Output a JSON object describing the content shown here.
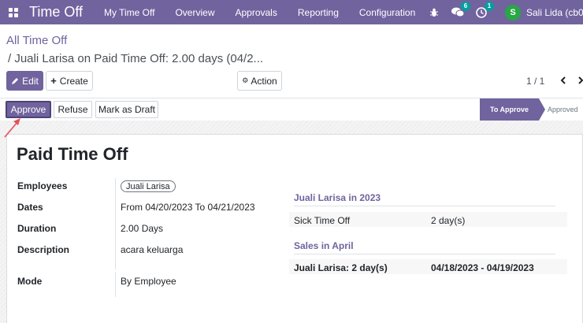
{
  "navbar": {
    "app_name": "Time Off",
    "menu": [
      "My Time Off",
      "Overview",
      "Approvals",
      "Reporting",
      "Configuration"
    ],
    "messages_count": "6",
    "activities_count": "1",
    "avatar_letter": "S",
    "user_name": "Sali Lida (cb0",
    "color": "#71639e"
  },
  "breadcrumb": {
    "parent": "All Time Off",
    "current": "/ Juali Larisa on Paid Time Off: 2.00 days (04/2..."
  },
  "controls": {
    "edit": "Edit",
    "create": "Create",
    "action": "Action",
    "pager": "1 / 1"
  },
  "statusbar": {
    "approve": "Approve",
    "refuse": "Refuse",
    "draft": "Mark as Draft",
    "stage_active": "To Approve",
    "stage_next": "Approved"
  },
  "form": {
    "title": "Paid Time Off",
    "employees_label": "Employees",
    "employee": "Juali Larisa",
    "dates_label": "Dates",
    "dates": "From 04/20/2023 To 04/21/2023",
    "duration_label": "Duration",
    "duration": "2.00 Days",
    "description_label": "Description",
    "description": "acara keluarga",
    "mode_label": "Mode",
    "mode": "By Employee"
  },
  "side": {
    "section1": "Juali Larisa in 2023",
    "row1_label": "Sick Time Off",
    "row1_value": "2 day(s)",
    "section2": "Sales in April",
    "row2_label": "Juali Larisa: 2 day(s)",
    "row2_value": "04/18/2023 - 04/19/2023"
  }
}
